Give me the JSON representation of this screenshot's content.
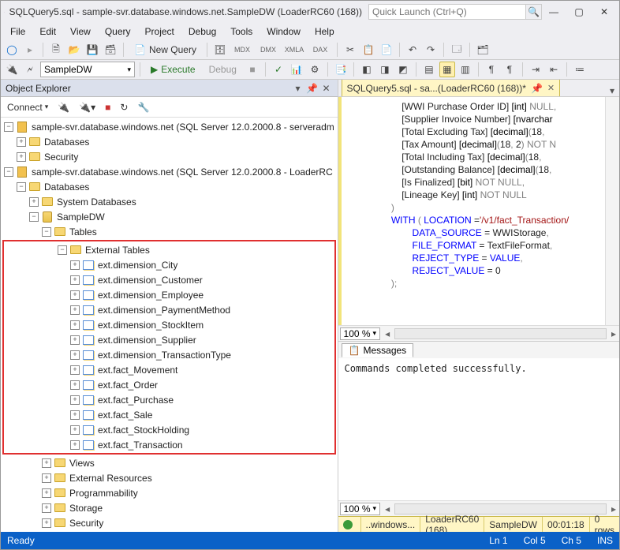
{
  "title": "SQLQuery5.sql - sample-svr.database.windows.net.SampleDW (LoaderRC60 (168))",
  "quicklaunch_placeholder": "Quick Launch (Ctrl+Q)",
  "menu": [
    "File",
    "Edit",
    "View",
    "Query",
    "Project",
    "Debug",
    "Tools",
    "Window",
    "Help"
  ],
  "toolbar2": {
    "combo": "SampleDW",
    "execute": "Execute",
    "debug": "Debug"
  },
  "newquery": "New Query",
  "explorer": {
    "title": "Object Explorer",
    "connect": "Connect",
    "server1": "sample-svr.database.windows.net (SQL Server 12.0.2000.8 - serveradm",
    "server2": "sample-svr.database.windows.net (SQL Server 12.0.2000.8 - LoaderRC",
    "databases": "Databases",
    "security": "Security",
    "sysdb": "System Databases",
    "sampledw": "SampleDW",
    "tables": "Tables",
    "ext_tables": "External Tables",
    "ext_list": [
      "ext.dimension_City",
      "ext.dimension_Customer",
      "ext.dimension_Employee",
      "ext.dimension_PaymentMethod",
      "ext.dimension_StockItem",
      "ext.dimension_Supplier",
      "ext.dimension_TransactionType",
      "ext.fact_Movement",
      "ext.fact_Order",
      "ext.fact_Purchase",
      "ext.fact_Sale",
      "ext.fact_StockHolding",
      "ext.fact_Transaction"
    ],
    "views": "Views",
    "extres": "External Resources",
    "prog": "Programmability",
    "storage": "Storage",
    "sec2": "Security"
  },
  "tab": "SQLQuery5.sql - sa...(LoaderRC60 (168))*",
  "code_lines": [
    {
      "indent": 8,
      "parts": [
        {
          "t": "[WWI Purchase Order ID] "
        },
        {
          "t": "[int]",
          "c": "type"
        },
        {
          "t": " NULL",
          "c": "gray"
        },
        {
          "t": ",",
          "c": "gray"
        }
      ]
    },
    {
      "indent": 8,
      "parts": [
        {
          "t": "[Supplier Invoice Number] "
        },
        {
          "t": "[nvarchar",
          "c": "type"
        }
      ]
    },
    {
      "indent": 8,
      "parts": [
        {
          "t": "[Total Excluding Tax] "
        },
        {
          "t": "[decimal]",
          "c": "type"
        },
        {
          "t": "(",
          "c": "gray"
        },
        {
          "t": "18"
        },
        {
          "t": ",",
          "c": "gray"
        }
      ]
    },
    {
      "indent": 8,
      "parts": [
        {
          "t": "[Tax Amount] "
        },
        {
          "t": "[decimal]",
          "c": "type"
        },
        {
          "t": "(",
          "c": "gray"
        },
        {
          "t": "18"
        },
        {
          "t": ", ",
          "c": "gray"
        },
        {
          "t": "2"
        },
        {
          "t": ") ",
          "c": "gray"
        },
        {
          "t": "NOT N",
          "c": "gray"
        }
      ]
    },
    {
      "indent": 8,
      "parts": [
        {
          "t": "[Total Including Tax] "
        },
        {
          "t": "[decimal]",
          "c": "type"
        },
        {
          "t": "(",
          "c": "gray"
        },
        {
          "t": "18"
        },
        {
          "t": ",",
          "c": "gray"
        }
      ]
    },
    {
      "indent": 8,
      "parts": [
        {
          "t": "[Outstanding Balance] "
        },
        {
          "t": "[decimal]",
          "c": "type"
        },
        {
          "t": "(",
          "c": "gray"
        },
        {
          "t": "18"
        },
        {
          "t": ",",
          "c": "gray"
        }
      ]
    },
    {
      "indent": 8,
      "parts": [
        {
          "t": "[Is Finalized] "
        },
        {
          "t": "[bit]",
          "c": "type"
        },
        {
          "t": " NOT NULL",
          "c": "gray"
        },
        {
          "t": ",",
          "c": "gray"
        }
      ]
    },
    {
      "indent": 8,
      "parts": [
        {
          "t": "[Lineage Key] "
        },
        {
          "t": "[int]",
          "c": "type"
        },
        {
          "t": " NOT NULL",
          "c": "gray"
        }
      ]
    },
    {
      "indent": 4,
      "parts": [
        {
          "t": ")",
          "c": "gray"
        }
      ]
    },
    {
      "indent": 4,
      "parts": [
        {
          "t": "WITH",
          "c": "kw"
        },
        {
          "t": " ( ",
          "c": "gray"
        },
        {
          "t": "LOCATION",
          "c": "kw"
        },
        {
          "t": " ="
        },
        {
          "t": "'/v1/fact_Transaction/",
          "c": "str"
        }
      ]
    },
    {
      "indent": 8,
      "parts": [
        {
          "t": "    DATA_SOURCE",
          "c": "kw"
        },
        {
          "t": " = "
        },
        {
          "t": "WWIStorage"
        },
        {
          "t": ",",
          "c": "gray"
        }
      ]
    },
    {
      "indent": 8,
      "parts": [
        {
          "t": "    FILE_FORMAT",
          "c": "kw"
        },
        {
          "t": " = "
        },
        {
          "t": "TextFileFormat"
        },
        {
          "t": ",",
          "c": "gray"
        }
      ]
    },
    {
      "indent": 8,
      "parts": [
        {
          "t": "    REJECT_TYPE",
          "c": "kw"
        },
        {
          "t": " = "
        },
        {
          "t": "VALUE",
          "c": "kw"
        },
        {
          "t": ",",
          "c": "gray"
        }
      ]
    },
    {
      "indent": 8,
      "parts": [
        {
          "t": "    REJECT_VALUE",
          "c": "kw"
        },
        {
          "t": " = "
        },
        {
          "t": "0"
        }
      ]
    },
    {
      "indent": 4,
      "parts": [
        {
          "t": ");",
          "c": "gray"
        }
      ]
    }
  ],
  "zoom": "100 %",
  "messages_tab": "Messages",
  "messages_body": "Commands completed successfully.",
  "status": {
    "conn": "..windows...",
    "user": "LoaderRC60 (168)",
    "db": "SampleDW",
    "time": "00:01:18",
    "rows": "0 rows"
  },
  "appstatus": {
    "ready": "Ready",
    "ln": "Ln 1",
    "col": "Col 5",
    "ch": "Ch 5",
    "ins": "INS"
  }
}
